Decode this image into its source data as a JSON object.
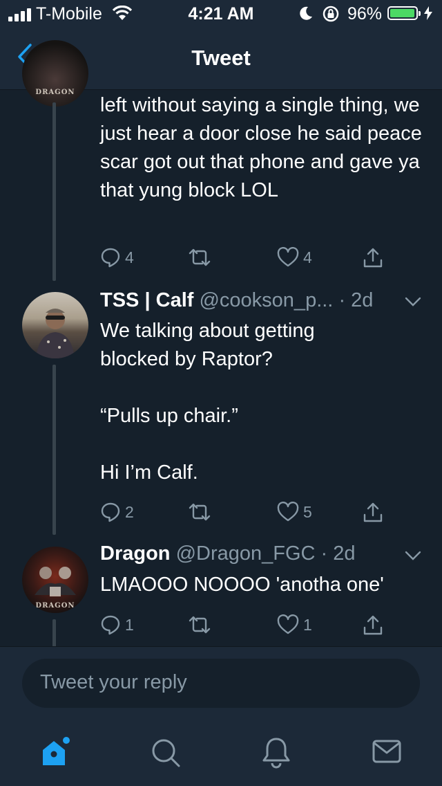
{
  "status_bar": {
    "carrier": "T-Mobile",
    "time": "4:21 AM",
    "battery": "96%",
    "battery_level": 0.96
  },
  "nav": {
    "title": "Tweet"
  },
  "tweets": [
    {
      "text": "left without saying a single thing, we just hear a door close he said peace scar got out that phone and gave ya that yung block LOL",
      "avatar_label": "DRAGON",
      "replies": "4",
      "likes": "4"
    },
    {
      "name": "TSS | Calf",
      "handle": "@cookson_p...",
      "time": "· 2d",
      "line1": "We talking about getting blocked by Raptor?",
      "line2": "“Pulls up chair.”",
      "line3": "Hi I’m Calf.",
      "replies": "2",
      "likes": "5"
    },
    {
      "name": "Dragon",
      "handle": "@Dragon_FGC",
      "time": "· 2d",
      "text": "LMAOOO NOOOO 'anotha one'",
      "avatar_label": "DRAGON",
      "replies": "1",
      "likes": "1"
    }
  ],
  "reply": {
    "placeholder": "Tweet your reply"
  },
  "tabs": [
    "home-icon",
    "search-icon",
    "notifications-icon",
    "messages-icon"
  ],
  "colors": {
    "background": "#15202b",
    "bar": "#1c2938",
    "accent": "#1da1f2",
    "muted": "#8899a6"
  }
}
